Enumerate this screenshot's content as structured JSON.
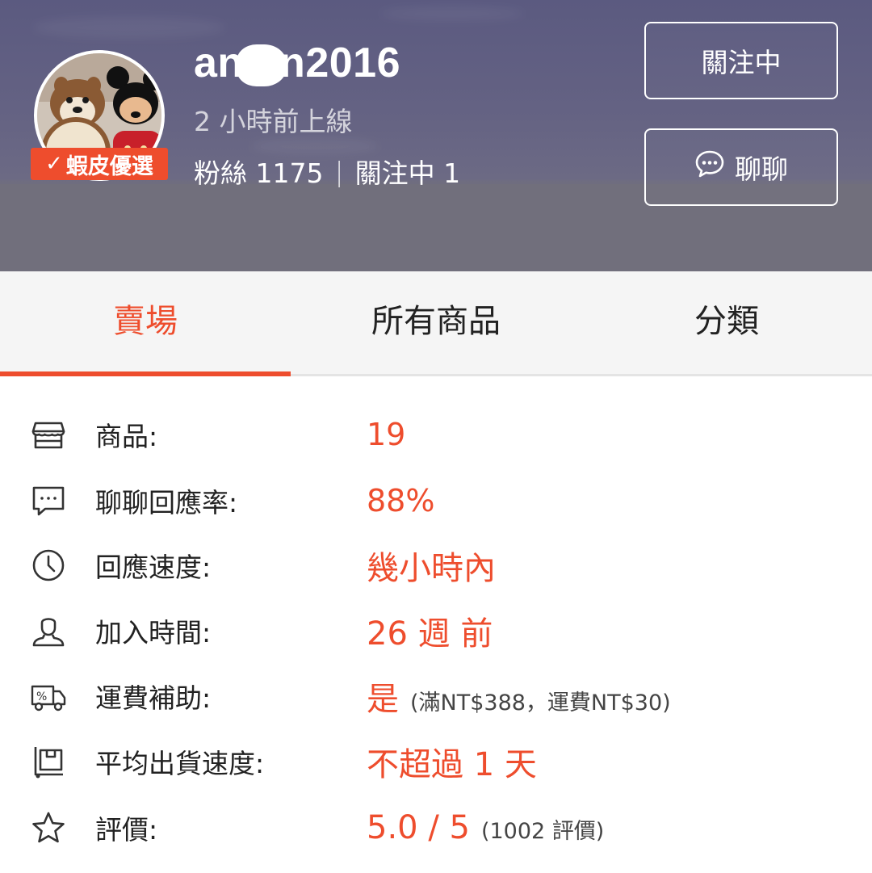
{
  "profile": {
    "username": "an  an2016",
    "online_status": "2 小時前上線",
    "followers_label": "粉絲",
    "followers_count": "1175",
    "following_label": "關注中",
    "following_count": "1",
    "separator": "|",
    "badge_label": "蝦皮優選"
  },
  "buttons": {
    "follow_label": "關注中",
    "chat_label": "聊聊"
  },
  "tabs": [
    {
      "label": "賣場",
      "active": true
    },
    {
      "label": "所有商品",
      "active": false
    },
    {
      "label": "分類",
      "active": false
    }
  ],
  "info": {
    "products": {
      "label": "商品:",
      "value": "19",
      "icon": "shop-icon"
    },
    "chat_response_rate": {
      "label": "聊聊回應率:",
      "value": "88%",
      "icon": "chat-bubble-icon"
    },
    "response_speed": {
      "label": "回應速度:",
      "value": "幾小時內",
      "icon": "clock-icon"
    },
    "joined": {
      "label": "加入時間:",
      "value": "26 週 前",
      "icon": "user-icon"
    },
    "shipping_subsidy": {
      "label": "運費補助:",
      "value": "是",
      "note": "(滿NT$388，運費NT$30)",
      "icon": "truck-discount-icon"
    },
    "avg_ship_speed": {
      "label": "平均出貨速度:",
      "value": "不超過 1 天",
      "icon": "package-cart-icon"
    },
    "rating": {
      "label": "評價:",
      "value": "5.0 / 5",
      "note": "(1002 評價)",
      "icon": "star-icon"
    }
  },
  "colors": {
    "accent": "#ee4d2d",
    "header_bg": "#646283",
    "tab_bg": "#f5f5f5"
  }
}
